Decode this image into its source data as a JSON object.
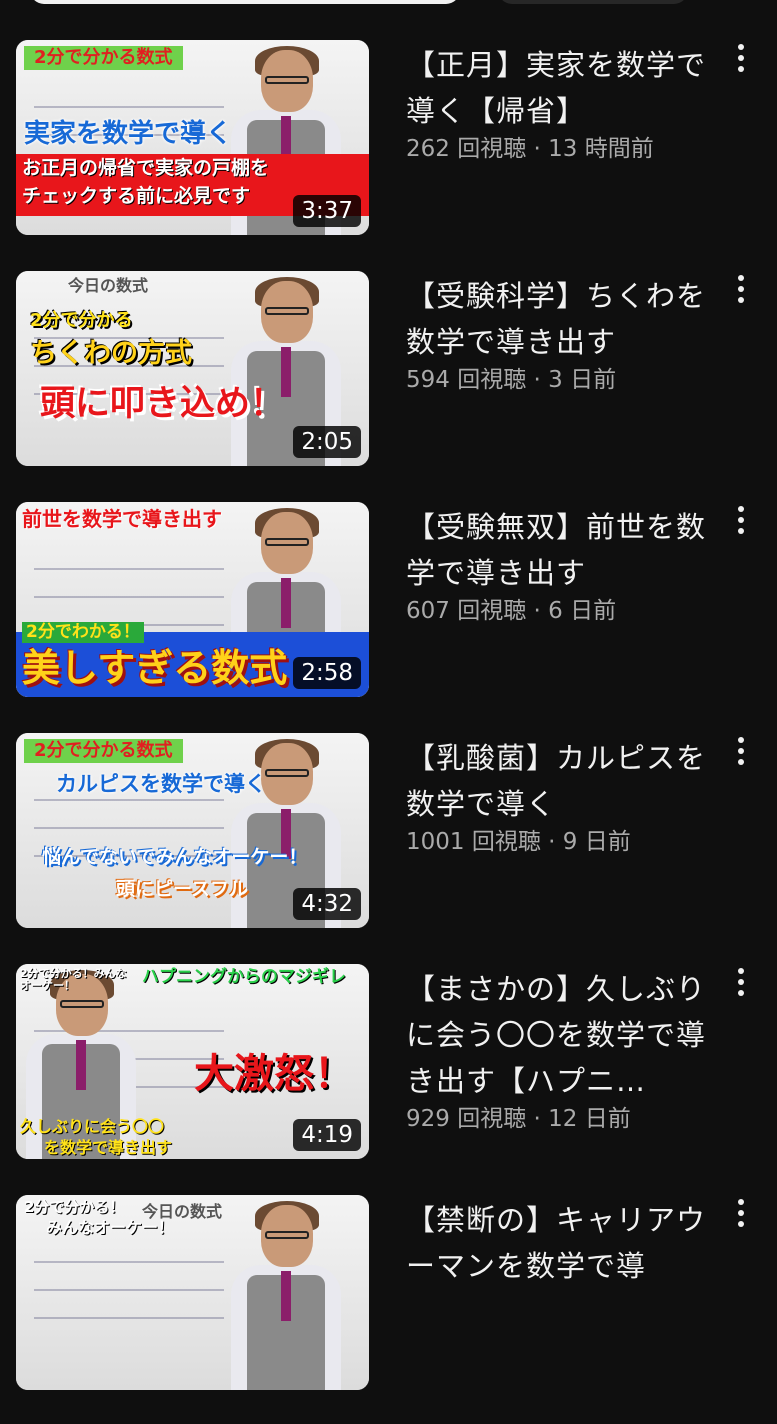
{
  "videos": [
    {
      "title": "【正月】実家を数学で導く【帰省】",
      "views": "262 回視聴",
      "age": "13 時間前",
      "duration": "3:37",
      "thumb": {
        "top_label": "2分で分かる数式",
        "headline": "実家を数学で導く",
        "line1": "お正月の帰省で実家の戸棚を",
        "line2": "チェックする前に必見です"
      }
    },
    {
      "title": "【受験科学】ちくわを数学で導き出す",
      "views": "594 回視聴",
      "age": "3 日前",
      "duration": "2:05",
      "thumb": {
        "board_text": "今日の数式",
        "label1": "2分で分かる",
        "label2": "ちくわの方式",
        "headline": "頭に叩き込め！"
      }
    },
    {
      "title": "【受験無双】前世を数学で導き出す",
      "views": "607 回視聴",
      "age": "6 日前",
      "duration": "2:58",
      "thumb": {
        "top_label": "前世を数学で導き出す",
        "label1": "2分でわかる！",
        "headline": "美しすぎる数式"
      }
    },
    {
      "title": "【乳酸菌】カルピスを数学で導く",
      "views": "1001 回視聴",
      "age": "9 日前",
      "duration": "4:32",
      "thumb": {
        "top_label": "2分で分かる数式",
        "headline": "カルピスを数学で導く",
        "line1": "悩んでないでみんなオーケー！",
        "line2": "頭にピースフル"
      }
    },
    {
      "title": "【まさかの】久しぶりに会う〇〇を数学で導き出す【ハプニ…",
      "views": "929 回視聴",
      "age": "12 日前",
      "duration": "4:19",
      "thumb": {
        "top_label": "2分で分かる！みんなオーケー！",
        "banner": "ハプニングからのマジギレ",
        "headline": "大激怒！",
        "line1": "久しぶりに会う〇〇",
        "line2": "を数学で導き出す"
      }
    },
    {
      "title": "【禁断の】キャリアウーマンを数学で導",
      "views": "",
      "age": "",
      "duration": "",
      "thumb": {
        "top_label": "2分で分かる！",
        "label1": "みんなオーケー！",
        "board_text": "今日の数式"
      }
    }
  ],
  "meta_separator": " · ",
  "colors": {
    "background": "#0f0f0f",
    "title_text": "#f1f1f1",
    "meta_text": "#aaaaaa",
    "duration_bg": "#000000"
  },
  "icons": {
    "menu": "more-vert-icon"
  }
}
